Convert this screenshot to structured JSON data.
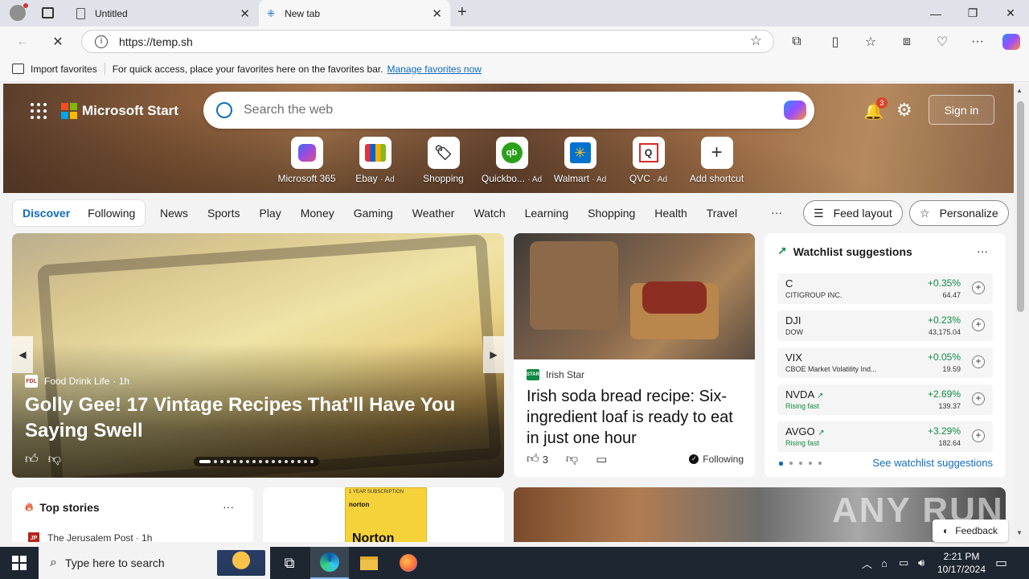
{
  "browser": {
    "tabs": [
      {
        "title": "Untitled",
        "icon": "page-icon",
        "state": "inactive"
      },
      {
        "title": "New tab",
        "icon": "edge-newtab-icon",
        "state": "active"
      }
    ],
    "window_controls": {
      "minimize": "—",
      "restore": "❐",
      "close": "✕"
    },
    "address": {
      "url": "https://temp.sh"
    },
    "favorites_bar": {
      "import_label": "Import favorites",
      "hint": "For quick access, place your favorites here on the favorites bar.",
      "manage_link": "Manage favorites now"
    }
  },
  "start": {
    "brand": "Microsoft Start",
    "search_placeholder": "Search the web",
    "notification_count": "3",
    "sign_in": "Sign in",
    "shortcuts": [
      {
        "label": "Microsoft 365",
        "ad": "",
        "icon": "microsoft-365-icon"
      },
      {
        "label": "Ebay",
        "ad": "· Ad",
        "icon": "ebay-icon"
      },
      {
        "label": "Shopping",
        "ad": "",
        "icon": "shopping-tag-icon"
      },
      {
        "label": "Quickbo...",
        "ad": "· Ad",
        "icon": "quickbooks-icon"
      },
      {
        "label": "Walmart",
        "ad": "· Ad",
        "icon": "walmart-icon"
      },
      {
        "label": "QVC",
        "ad": "· Ad",
        "icon": "qvc-icon"
      },
      {
        "label": "Add shortcut",
        "ad": "",
        "icon": "plus-icon"
      }
    ],
    "nav": {
      "discover": "Discover",
      "following": "Following",
      "items": [
        "News",
        "Sports",
        "Play",
        "Money",
        "Gaming",
        "Weather",
        "Watch",
        "Learning",
        "Shopping",
        "Health",
        "Travel"
      ],
      "more": "···",
      "feed_layout": "Feed layout",
      "personalize": "Personalize"
    }
  },
  "cards": {
    "main": {
      "source": "Food Drink Life",
      "source_badge": "FDL",
      "time": "· 1h",
      "title": "Golly Gee! 17 Vintage Recipes That'll Have You Saying Swell"
    },
    "bread": {
      "source": "Irish Star",
      "source_badge": "STAR",
      "title": "Irish soda bread recipe: Six-ingredient loaf is ready to eat in just one hour",
      "likes": "3",
      "following": "Following"
    },
    "watchlist": {
      "title": "Watchlist suggestions",
      "more": "···",
      "link": "See watchlist suggestions",
      "stocks": [
        {
          "symbol": "C",
          "name": "CITIGROUP INC.",
          "change": "+0.35%",
          "price": "64.47",
          "rising": false
        },
        {
          "symbol": "DJI",
          "name": "DOW",
          "change": "+0.23%",
          "price": "43,175.04",
          "rising": false
        },
        {
          "symbol": "VIX",
          "name": "CBOE Market Volatility Ind...",
          "change": "+0.05%",
          "price": "19.59",
          "rising": false
        },
        {
          "symbol": "NVDA",
          "name": "Rising fast",
          "change": "+2.69%",
          "price": "139.37",
          "rising": true
        },
        {
          "symbol": "AVGO",
          "name": "Rising fast",
          "change": "+3.29%",
          "price": "182.64",
          "rising": true
        }
      ]
    },
    "top_stories": {
      "title": "Top stories",
      "more": "···",
      "source": "The Jerusalem Post",
      "source_badge": "JP",
      "time": "· 1h"
    },
    "ad": {
      "subtitle": "1 YEAR SUBSCRIPTION",
      "brand": "norton",
      "product": "Norton"
    },
    "feedback": "Feedback",
    "watermark": "ANY RUN"
  },
  "taskbar": {
    "search_placeholder": "Type here to search",
    "time": "2:21 PM",
    "date": "10/17/2024"
  },
  "colors": {
    "accent": "#0f6cbd",
    "positive": "#0e8a43",
    "taskbar": "#1d2631"
  }
}
